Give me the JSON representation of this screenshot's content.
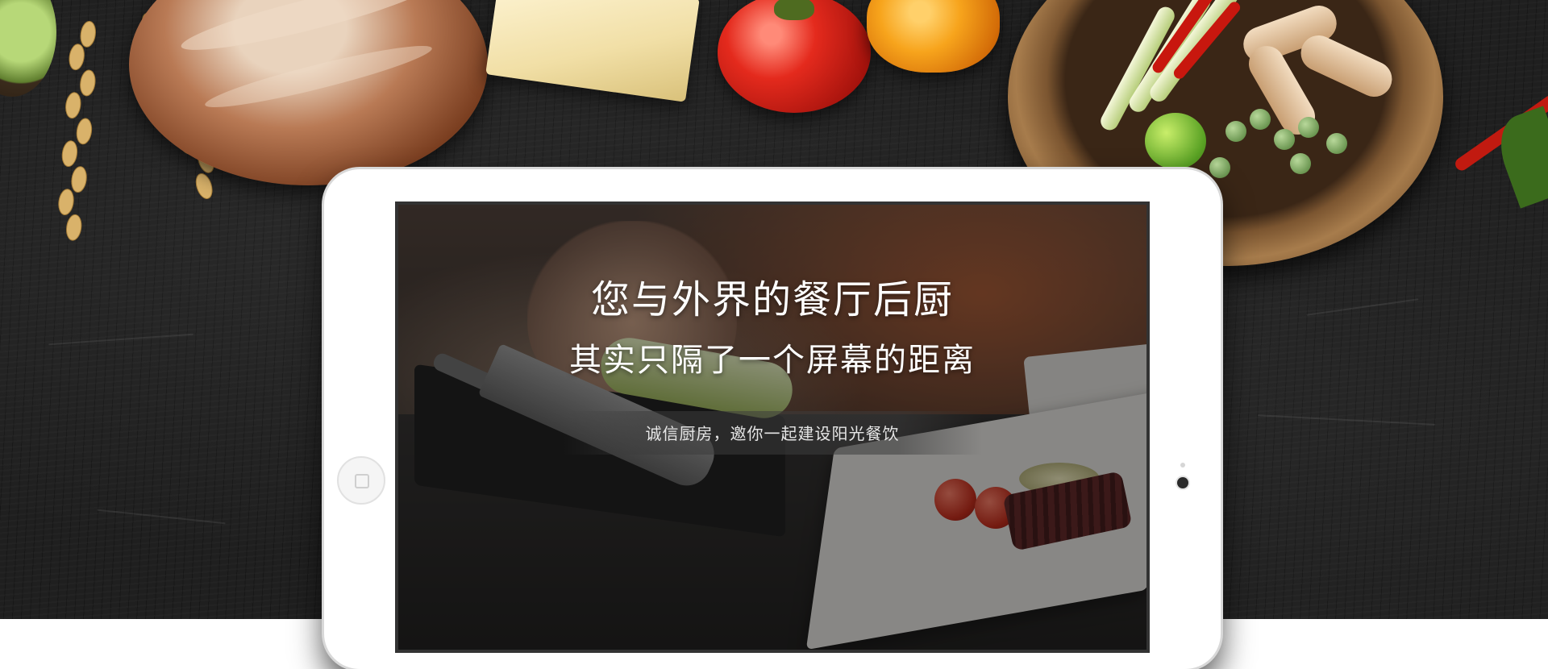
{
  "hero": {
    "headline_line1": "您与外界的餐厅后厨",
    "headline_line2": "其实只隔了一个屏幕的距离",
    "tagline": "诚信厨房，邀你一起建设阳光餐饮"
  },
  "colors": {
    "background": "#1f1f1f",
    "tablet_frame": "#ffffff",
    "headline_text": "#ffffff",
    "tagline_text": "#e6e6e6"
  },
  "icons": {
    "home_button": "tablet-home-button-icon",
    "camera": "tablet-camera-icon"
  }
}
